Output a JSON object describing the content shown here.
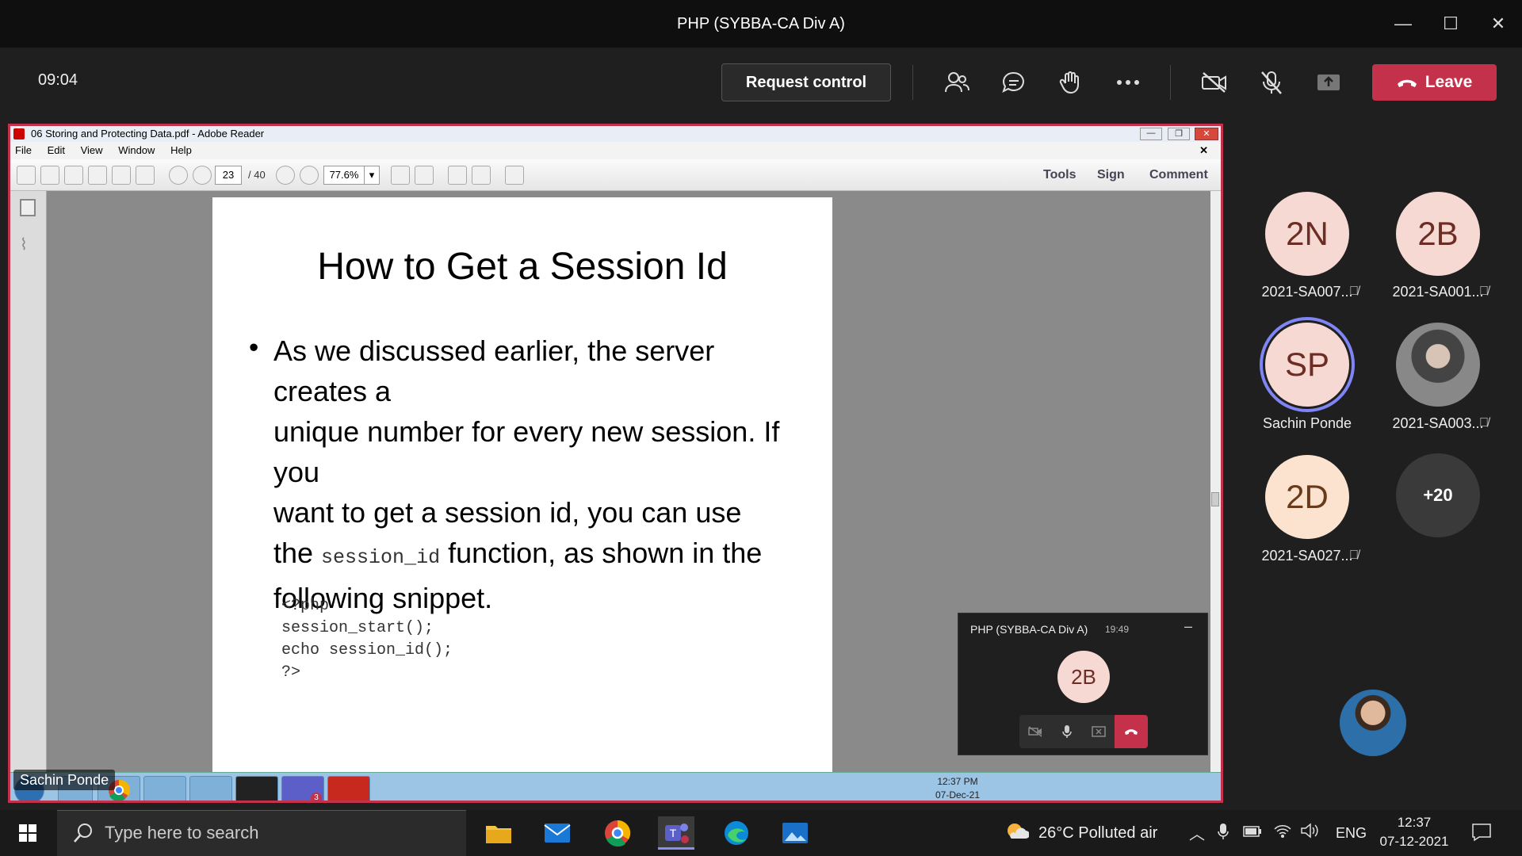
{
  "window": {
    "title": "PHP (SYBBA-CA Div A)"
  },
  "meeting": {
    "timer": "09:04",
    "request_control": "Request control",
    "leave": "Leave",
    "icons": [
      "people-icon",
      "chat-icon",
      "raise-hand-icon",
      "more-icon",
      "camera-off-icon",
      "mic-off-icon",
      "share-icon"
    ]
  },
  "reader": {
    "title": "06 Storing and Protecting Data.pdf - Adobe Reader",
    "menu": [
      "File",
      "Edit",
      "View",
      "Window",
      "Help"
    ],
    "page_current": "23",
    "page_total": "/ 40",
    "zoom": "77.6%",
    "tools": "Tools",
    "sign": "Sign",
    "comment": "Comment"
  },
  "slide": {
    "title": "How to Get a Session Id",
    "line1": "As we discussed earlier, the server creates a",
    "line2": "unique number for every new session. If you",
    "line3": "want to get a session id, you can use",
    "line4_pre": "the ",
    "line4_code": "session_id",
    "line4_post": " function, as shown in the",
    "line5": "following snippet.",
    "code": [
      "<?php",
      "session_start();",
      "echo session_id();",
      "?>"
    ]
  },
  "shared_taskbar": {
    "time": "12:37 PM",
    "date": "07-Dec-21",
    "teams_badge": "3"
  },
  "presenter_label": "Sachin Ponde",
  "mini_call": {
    "title": "PHP (SYBBA-CA Div A)",
    "time": "19:49",
    "avatar": "2B"
  },
  "participants": [
    {
      "initials": "2N",
      "name": "2021-SA007...",
      "muted": true,
      "bg": "#f7d9d3",
      "fg": "#6b2d24"
    },
    {
      "initials": "2B",
      "name": "2021-SA001...",
      "muted": true,
      "bg": "#f7d9d3",
      "fg": "#6b2d24"
    },
    {
      "initials": "SP",
      "name": "Sachin Ponde",
      "muted": false,
      "bg": "#f7d9d3",
      "fg": "#6b2d24"
    },
    {
      "initials": "",
      "name": "2021-SA003...",
      "muted": true,
      "bg": "#777777",
      "fg": "#ffffff"
    },
    {
      "initials": "2D",
      "name": "2021-SA027...",
      "muted": true,
      "bg": "#fbe3cf",
      "fg": "#6b3a1a"
    },
    {
      "initials": "+20",
      "name": "",
      "muted": false,
      "bg": "#3a3a3a",
      "fg": "#ffffff"
    }
  ],
  "taskbar": {
    "search_placeholder": "Type here to search",
    "weather": "26°C  Polluted air",
    "lang": "ENG",
    "time": "12:37",
    "date": "07-12-2021"
  }
}
